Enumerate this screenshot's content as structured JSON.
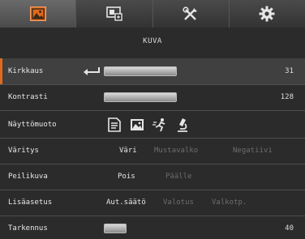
{
  "tabs": [
    {
      "name": "image-icon",
      "active": true
    },
    {
      "name": "display-settings-icon",
      "active": false
    },
    {
      "name": "tools-icon",
      "active": false
    },
    {
      "name": "gear-icon",
      "active": false
    }
  ],
  "page_title": "KUVA",
  "rows": {
    "brightness": {
      "label": "Kirkkaus",
      "value": "31",
      "level": 0.31
    },
    "contrast": {
      "label": "Kontrasti",
      "value": "128",
      "level": 0.5
    },
    "display_mode": {
      "label": "Näyttömuoto",
      "icons": [
        "document-icon",
        "photo-icon",
        "motion-icon",
        "microscope-icon"
      ]
    },
    "color": {
      "label": "Väritys",
      "options": [
        "Väri",
        "Mustavalko",
        "Negatiivi"
      ],
      "selected": "Väri"
    },
    "mirror": {
      "label": "Peilikuva",
      "options": [
        "Pois",
        "Päälle"
      ],
      "selected": "Pois"
    },
    "advanced": {
      "label": "Lisäasetus",
      "options": [
        "Aut.säätö",
        "Valotus",
        "Valkotp."
      ],
      "selected": "Aut.säätö"
    },
    "sharpness": {
      "label": "Tarkennus",
      "value": "40",
      "level": 0.15
    }
  },
  "colors": {
    "accent": "#e06a1b",
    "background": "#2b2b2b"
  }
}
